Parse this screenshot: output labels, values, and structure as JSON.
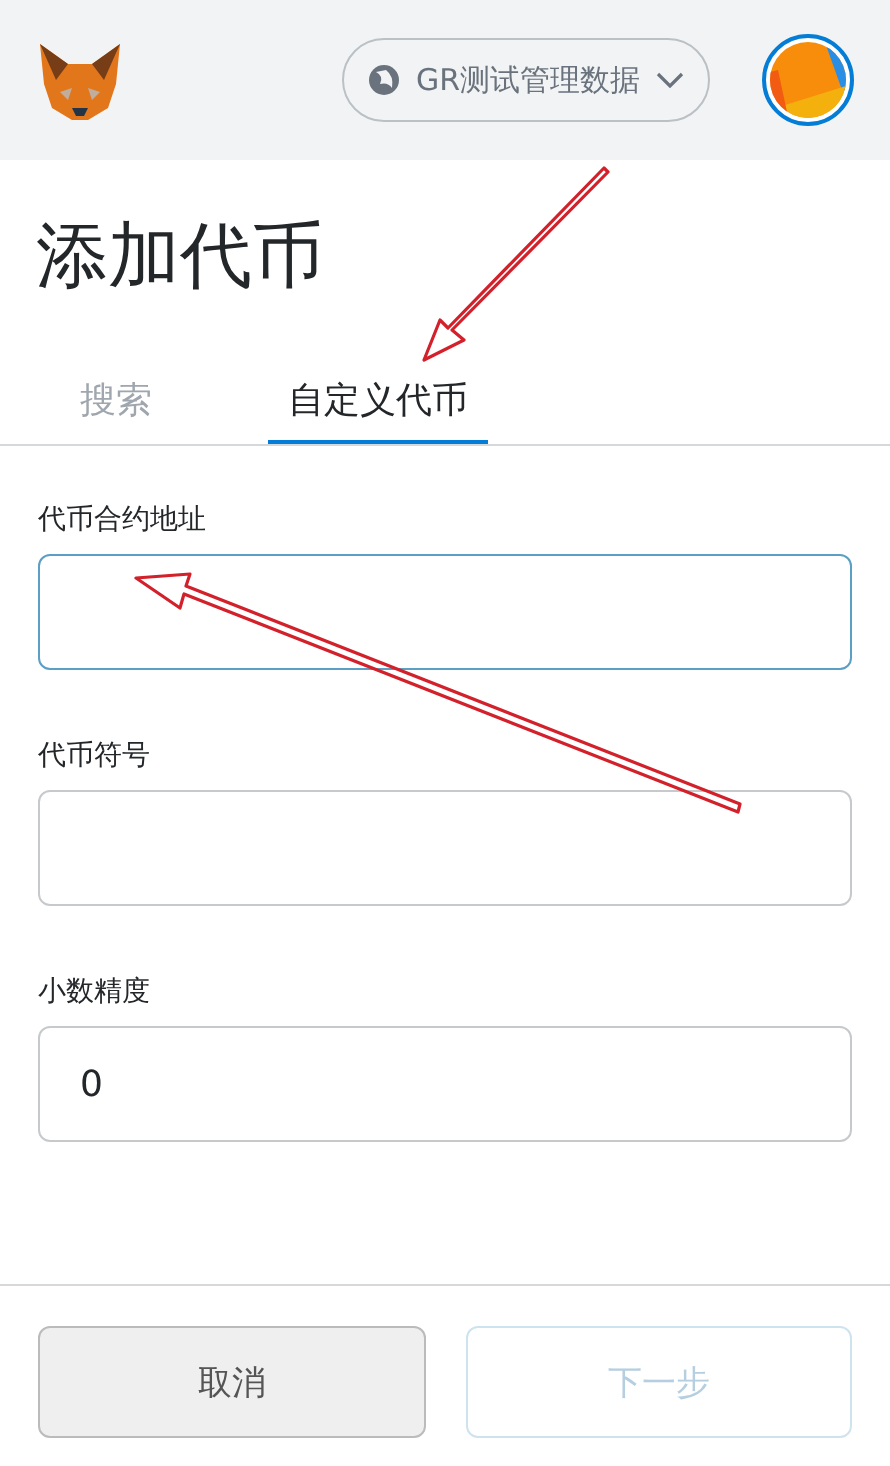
{
  "header": {
    "network": "GR测试管理数据"
  },
  "title": "添加代币",
  "tabs": [
    {
      "label": "搜索",
      "selected": false
    },
    {
      "label": "自定义代币",
      "selected": true
    }
  ],
  "fields": [
    {
      "label": "代币合约地址",
      "focused": true
    },
    {
      "label": "代币符号",
      "focused": false
    },
    {
      "label": "小数精度",
      "value": "0",
      "focused": false
    }
  ],
  "buttons": [
    {
      "label": "取消",
      "kind": "secondary",
      "disabled": false
    },
    {
      "label": "下一步",
      "kind": "primary",
      "disabled": true
    }
  ]
}
